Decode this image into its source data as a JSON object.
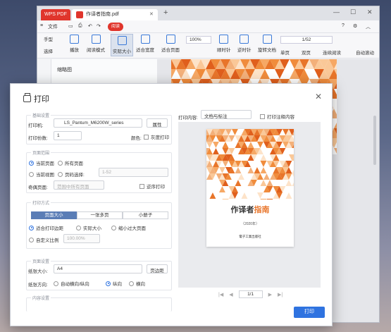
{
  "tabs": {
    "wps_label": "WPS PDF",
    "doc_label": "作译者指南.pdf"
  },
  "menu": {
    "file": "文件",
    "read": "阅读"
  },
  "toolbar": {
    "hand": "手型",
    "select": "选择",
    "play": "播放",
    "read_mode": "阅读模式",
    "actual_size": "实际大小",
    "fit_width": "适合宽度",
    "fit_page": "适合页面",
    "zoom": "100%",
    "rotate_cw": "顺时针",
    "rotate_ccw": "逆时针",
    "rotate_doc": "旋转文档",
    "page_indicator": "1/52",
    "single_page": "单页",
    "double_page": "双页",
    "continuous": "连续阅读",
    "auto_scroll": "自动滚动"
  },
  "sidebar": {
    "thumb_title": "缩略图"
  },
  "dialog": {
    "title": "打印",
    "basic": {
      "section": "基础设置",
      "printer_label": "打印机:",
      "printer_value": "LS_Pantum_M6200W_series",
      "properties_btn": "属性",
      "copies_label": "打印份数:",
      "copies_value": "1",
      "color_label": "颜色:",
      "gray_label": "灰度打印"
    },
    "range": {
      "section": "页面范围",
      "current_page": "当前页面",
      "all_pages": "所有页面",
      "current_view": "当前视图",
      "page_select": "页码选择:",
      "page_select_ph": "1-52",
      "odd_even_label": "奇偶页面:",
      "odd_even_value": "范围中所有页面",
      "reverse": "逆序打印"
    },
    "mode": {
      "section": "打印方式",
      "seg": [
        "页面大小",
        "一张多页",
        "小册子"
      ],
      "fit_margin": "适合打印边距",
      "actual_size": "实际大小",
      "shrink": "缩小过大页面",
      "custom": "自定义比例",
      "custom_value": "100.00%"
    },
    "setup": {
      "section": "页面设置",
      "paper_label": "纸张大小:",
      "paper_value": "A4",
      "margin_btn": "页边距",
      "orient_label": "纸张方向:",
      "auto": "自动横向/纵向",
      "portrait": "纵向",
      "landscape": "横向"
    },
    "more_section": "内容设置",
    "content_label": "打印内容:",
    "content_value": "文档与标注",
    "print_annot": "打印注释内容",
    "preview": {
      "title_a": "作译者",
      "title_b": "指南",
      "year": "（2020年）",
      "publisher": "電子工業出版社"
    },
    "pager": "1/1",
    "print_btn": "打印"
  },
  "colors": {
    "accent": "#2f73e0",
    "brand": "#e0352c",
    "orange": "#e8752a"
  }
}
